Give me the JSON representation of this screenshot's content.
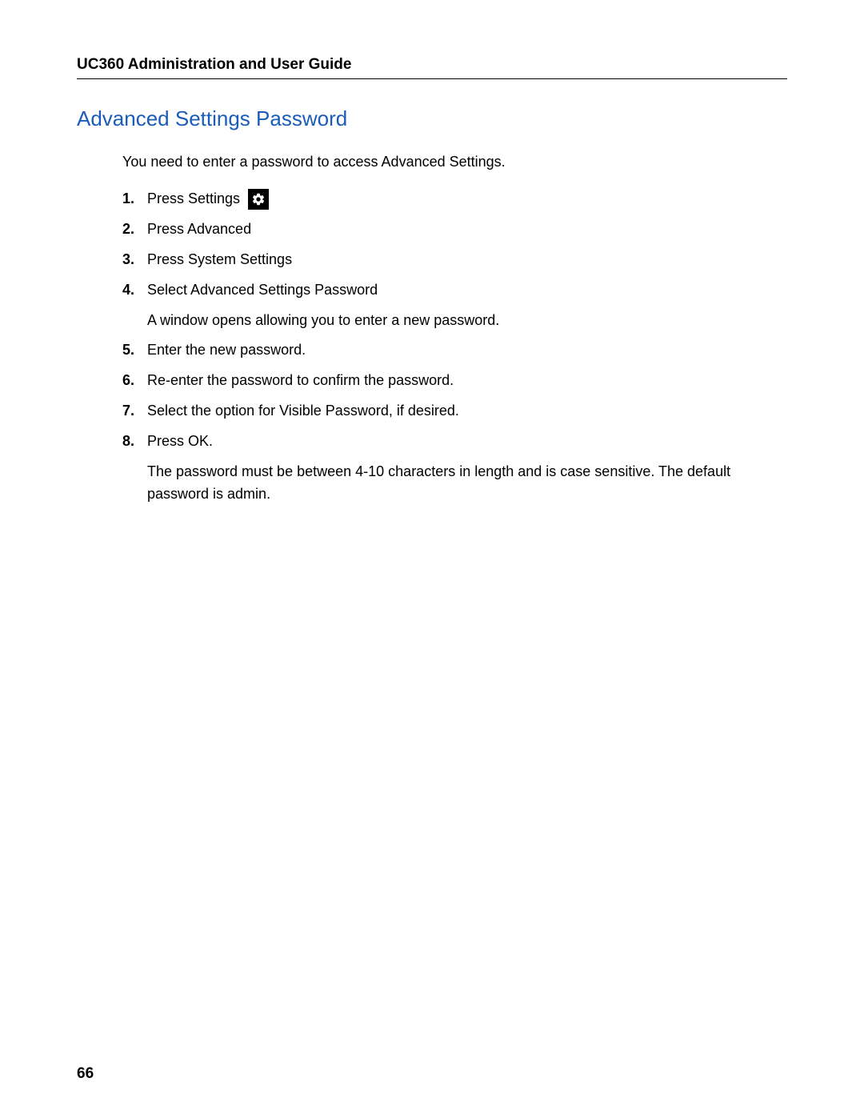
{
  "header": {
    "title": "UC360 Administration and User Guide"
  },
  "section": {
    "heading": "Advanced Settings Password",
    "intro": "You need to enter a password to access Advanced Settings.",
    "steps": {
      "s1": {
        "num": "1.",
        "text": "Press Settings"
      },
      "s2": {
        "num": "2.",
        "text": "Press Advanced"
      },
      "s3": {
        "num": "3.",
        "text": "Press System Settings"
      },
      "s4": {
        "num": "4.",
        "text": "Select Advanced Settings Password",
        "sub": "A window opens allowing you to enter a new password."
      },
      "s5": {
        "num": "5.",
        "text": "Enter the new password."
      },
      "s6": {
        "num": "6.",
        "text": "Re-enter the password to confirm the password."
      },
      "s7": {
        "num": "7.",
        "text": "Select the option for Visible Password, if desired."
      },
      "s8": {
        "num": "8.",
        "text": "Press OK.",
        "sub": "The password must be between 4-10 characters in length and is case sensitive. The default password is admin."
      }
    }
  },
  "pageNumber": "66"
}
